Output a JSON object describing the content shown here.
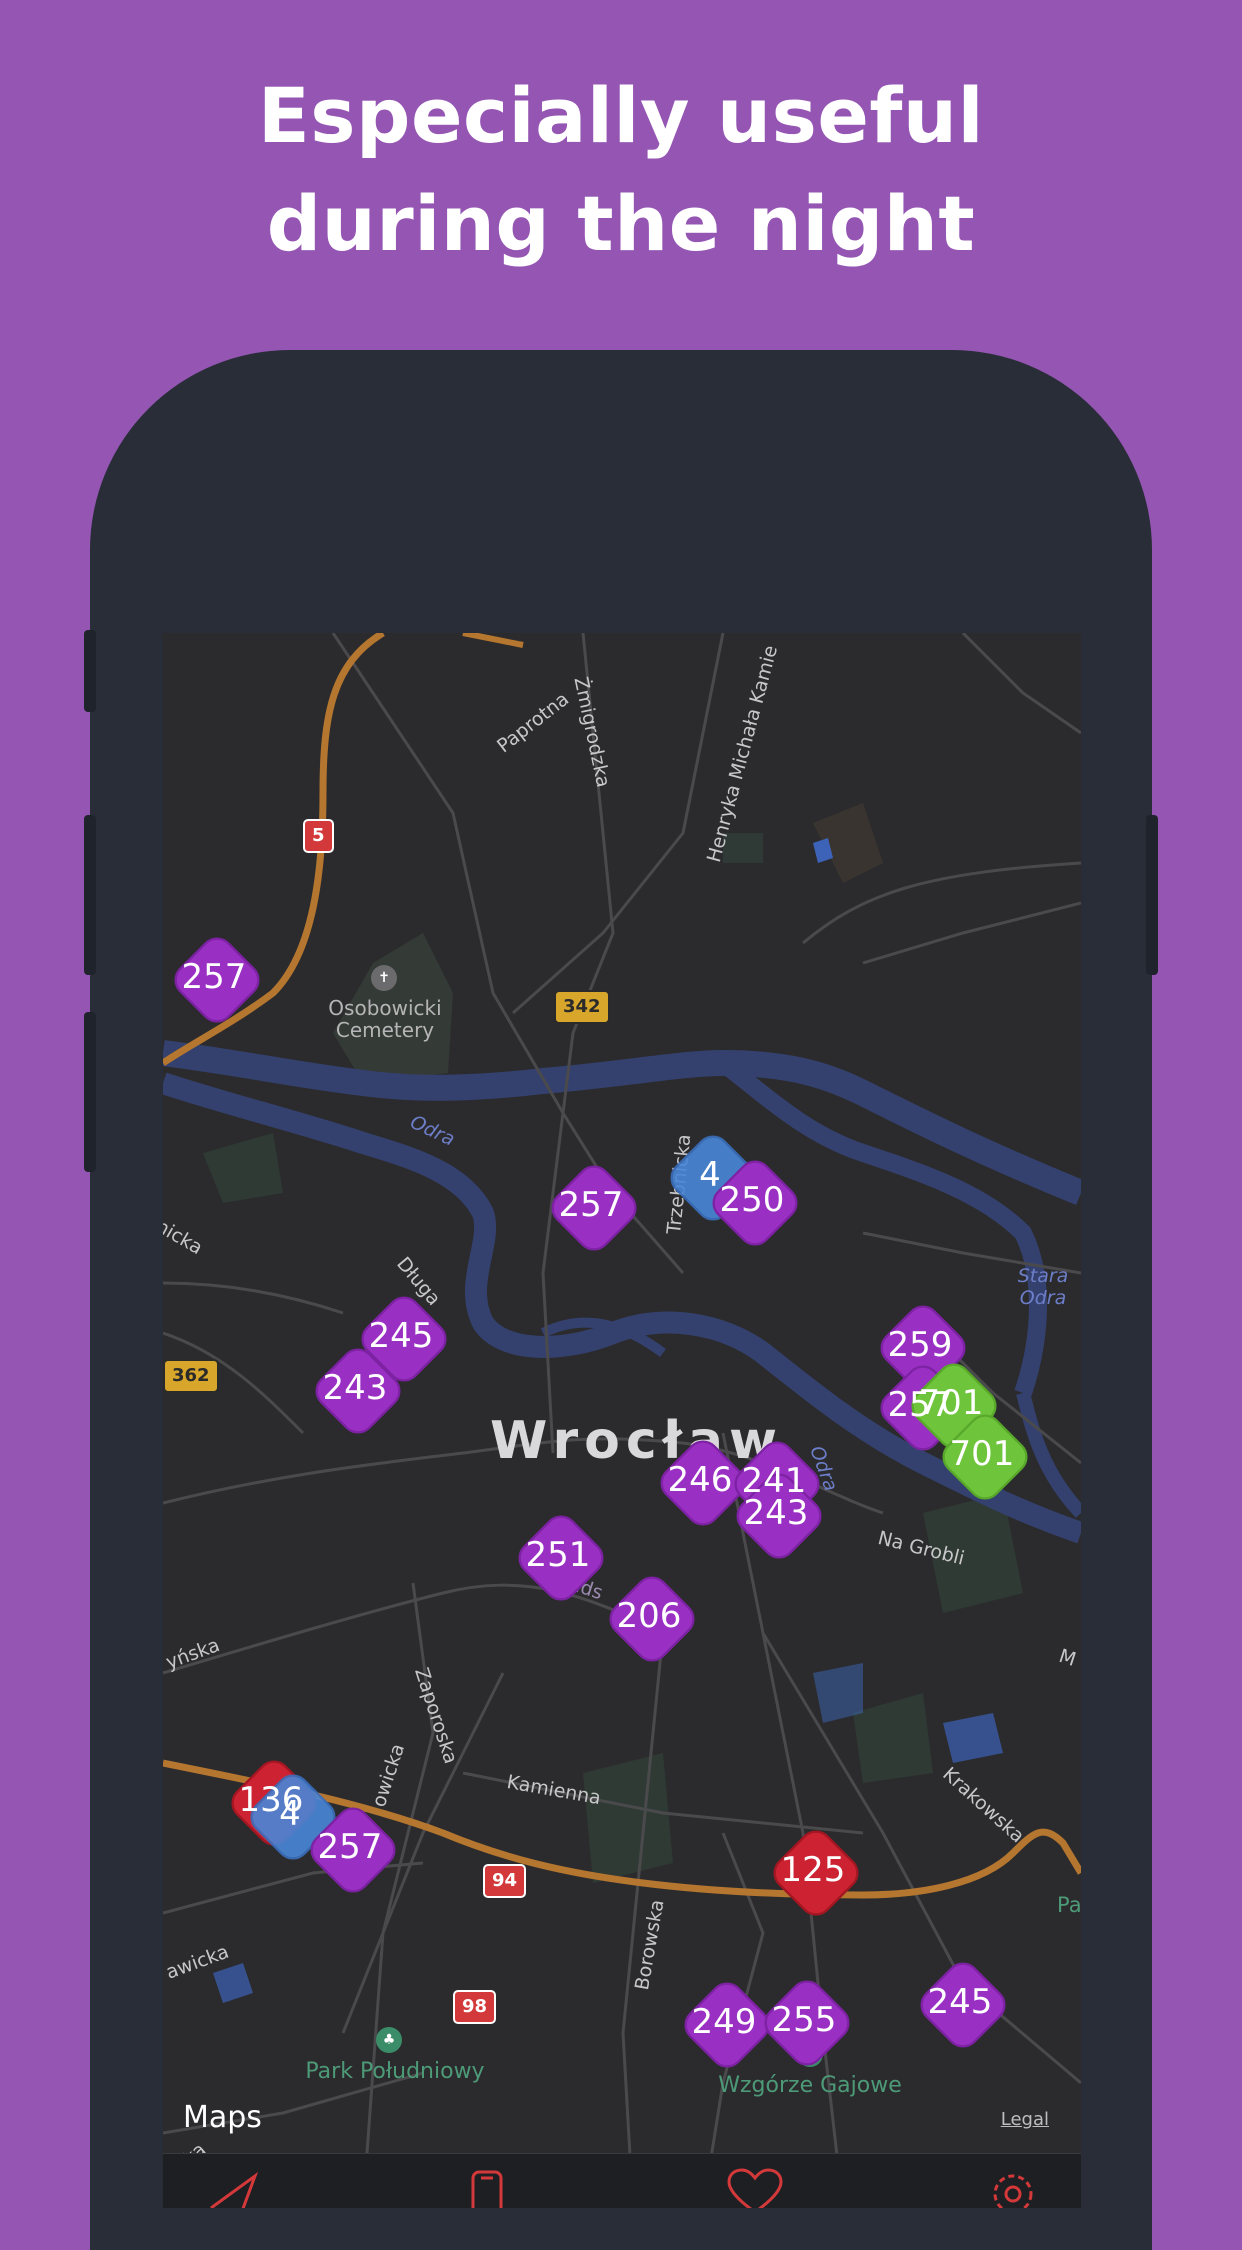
{
  "headline": {
    "line1": "Especially useful",
    "line2": "during the night"
  },
  "map": {
    "city": "Wrocław",
    "streets": [
      "Paprotna",
      "Żmigrodzka",
      "Henryka Michała Kamie",
      "Odra",
      "Trzebnicka",
      "nicka",
      "Długa",
      "Odra",
      "Na Grobli",
      "Piłsuds",
      "yńska",
      "Zaporoska",
      "owicka",
      "Kamienna",
      "Krakowska",
      "Borowska",
      "awicka",
      "icka",
      "Pa",
      "M"
    ],
    "pois": {
      "cemetery": "Osobowicki\nCemetery",
      "park_south": "Park Południowy",
      "park_hill": "Wzgórze Gajowe",
      "water": "Stara\nOdra"
    },
    "road_shields": [
      "5",
      "342",
      "362",
      "94",
      "98"
    ],
    "markers": [
      {
        "label": "257",
        "color": "purple"
      },
      {
        "label": "257",
        "color": "purple"
      },
      {
        "label": "4",
        "color": "blue"
      },
      {
        "label": "250",
        "color": "purple"
      },
      {
        "label": "245",
        "color": "purple"
      },
      {
        "label": "243",
        "color": "purple"
      },
      {
        "label": "259",
        "color": "purple"
      },
      {
        "label": "257",
        "color": "purple"
      },
      {
        "label": "701",
        "color": "green"
      },
      {
        "label": "701",
        "color": "green"
      },
      {
        "label": "246",
        "color": "purple"
      },
      {
        "label": "241",
        "color": "purple"
      },
      {
        "label": "243",
        "color": "purple"
      },
      {
        "label": "251",
        "color": "purple"
      },
      {
        "label": "206",
        "color": "purple"
      },
      {
        "label": "136",
        "color": "red"
      },
      {
        "label": "4",
        "color": "blue"
      },
      {
        "label": "257",
        "color": "purple"
      },
      {
        "label": "125",
        "color": "red"
      },
      {
        "label": "249",
        "color": "purple"
      },
      {
        "label": "255",
        "color": "purple"
      },
      {
        "label": "245",
        "color": "purple"
      }
    ],
    "attribution": "Maps",
    "legal": "Legal"
  },
  "tabbar": {
    "icons": [
      "location-arrow-icon",
      "phone-icon",
      "heart-icon",
      "settings-gear-icon"
    ],
    "accent": "#d3393a"
  },
  "colors": {
    "background": "#9455b3",
    "phone": "#282d37",
    "purple_marker": "#9a2fc4",
    "red_marker": "#cc2231",
    "blue_marker": "#4a86d8",
    "green_marker": "#6ec43a"
  }
}
